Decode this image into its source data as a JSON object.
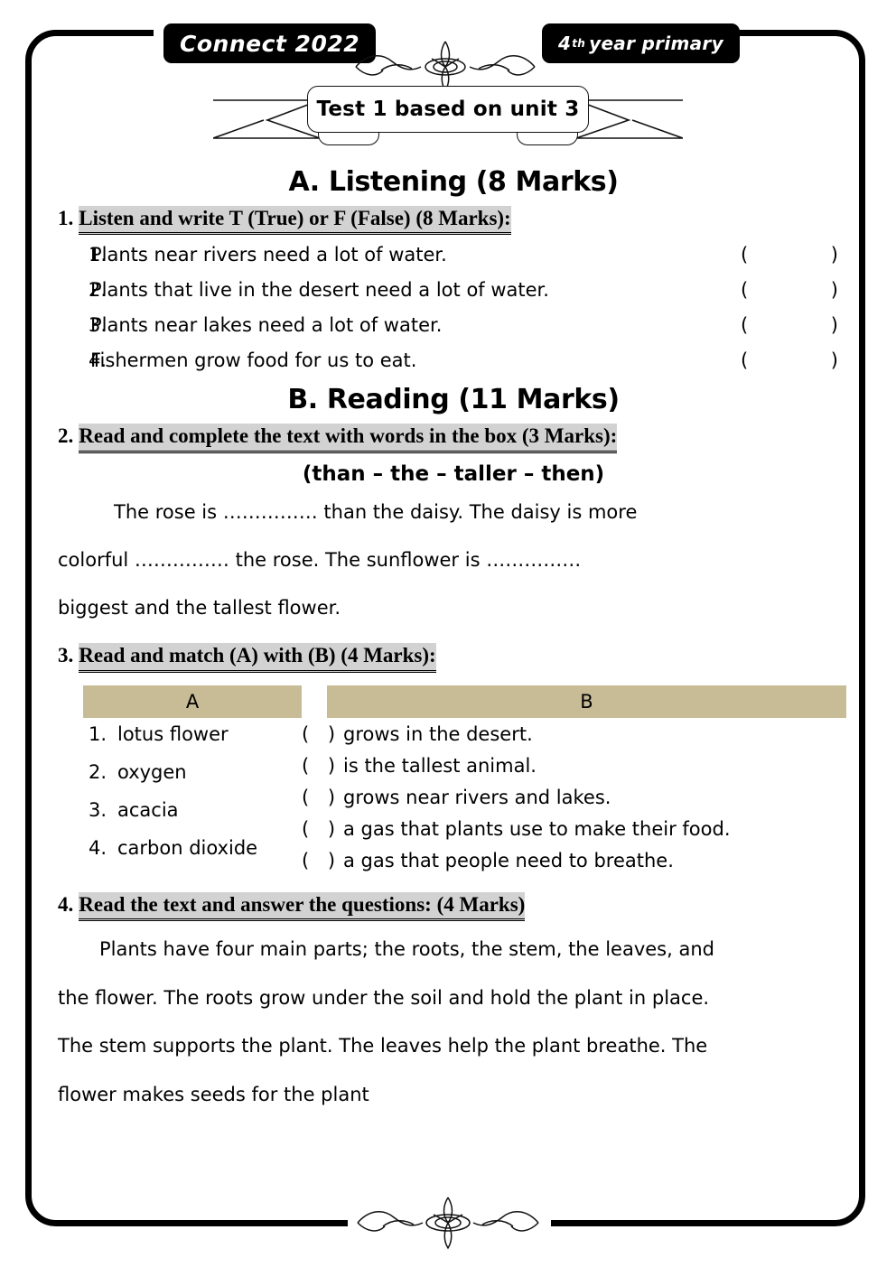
{
  "header": {
    "left_badge": "Connect 2022",
    "right_badge_number": "4",
    "right_badge_ordinal": "th",
    "right_badge_text": "year primary",
    "ribbon_title": "Test 1 based on unit 3",
    "ornament_top": "filigree-flourish",
    "ornament_bottom": "filigree-flourish"
  },
  "sections": {
    "listening": {
      "title": "A. Listening (8 Marks)",
      "question_number": "1.",
      "instruction": "Listen and write T (True) or F (False) (8 Marks):",
      "open_paren": "(",
      "close_paren": ")",
      "items": [
        {
          "index": "1.",
          "text": "Plants near rivers need a lot of water."
        },
        {
          "index": "2.",
          "text": "Plants that live in the desert need a lot of water."
        },
        {
          "index": "3.",
          "text": "Plants near lakes need a lot of water."
        },
        {
          "index": "4.",
          "text": "Fishermen grow food for us to eat."
        }
      ]
    },
    "reading": {
      "title": "B. Reading (11 Marks)",
      "q2": {
        "question_number": "2.",
        "instruction": "Read and complete the text with words in the box (3 Marks):",
        "word_box": "(than – the – taller – then)",
        "paragraph_line1": "The rose is …………… than the daisy. The daisy is more",
        "paragraph_line2": "colorful  ……………  the  rose.  The  sunflower  is  ……………",
        "paragraph_line3": "biggest and the tallest flower."
      },
      "q3": {
        "question_number": "3.",
        "instruction": "Read and match (A) with (B) (4 Marks):",
        "column_a_header": "A",
        "column_b_header": "B",
        "column_a": [
          {
            "index": "1.",
            "text": "lotus flower"
          },
          {
            "index": "2.",
            "text": "oxygen"
          },
          {
            "index": "3.",
            "text": "acacia"
          },
          {
            "index": "4.",
            "text": "carbon dioxide"
          }
        ],
        "column_b": [
          {
            "box": "(  )",
            "text": "grows in the desert."
          },
          {
            "box": "(  )",
            "text": "is the tallest animal."
          },
          {
            "box": "(  )",
            "text": "grows near rivers and lakes."
          },
          {
            "box": "(  )",
            "text": "a gas that plants use to make their food."
          },
          {
            "box": "(  )",
            "text": "a gas that people need to breathe."
          }
        ]
      },
      "q4": {
        "question_number": "4.",
        "instruction": "Read the text and answer the questions: (4 Marks)",
        "passage_line1": "Plants have four main parts; the roots, the stem, the leaves, and",
        "passage_line2": "the flower. The roots grow under the soil and hold the plant in place.",
        "passage_line3": "The stem supports the plant. The leaves help the plant breathe. The",
        "passage_line4": "flower makes seeds for the plant"
      }
    }
  },
  "colors": {
    "highlight": "#d2d2d2",
    "table_header": "#c8bc96",
    "badge_background": "#000000",
    "border": "#000000"
  }
}
